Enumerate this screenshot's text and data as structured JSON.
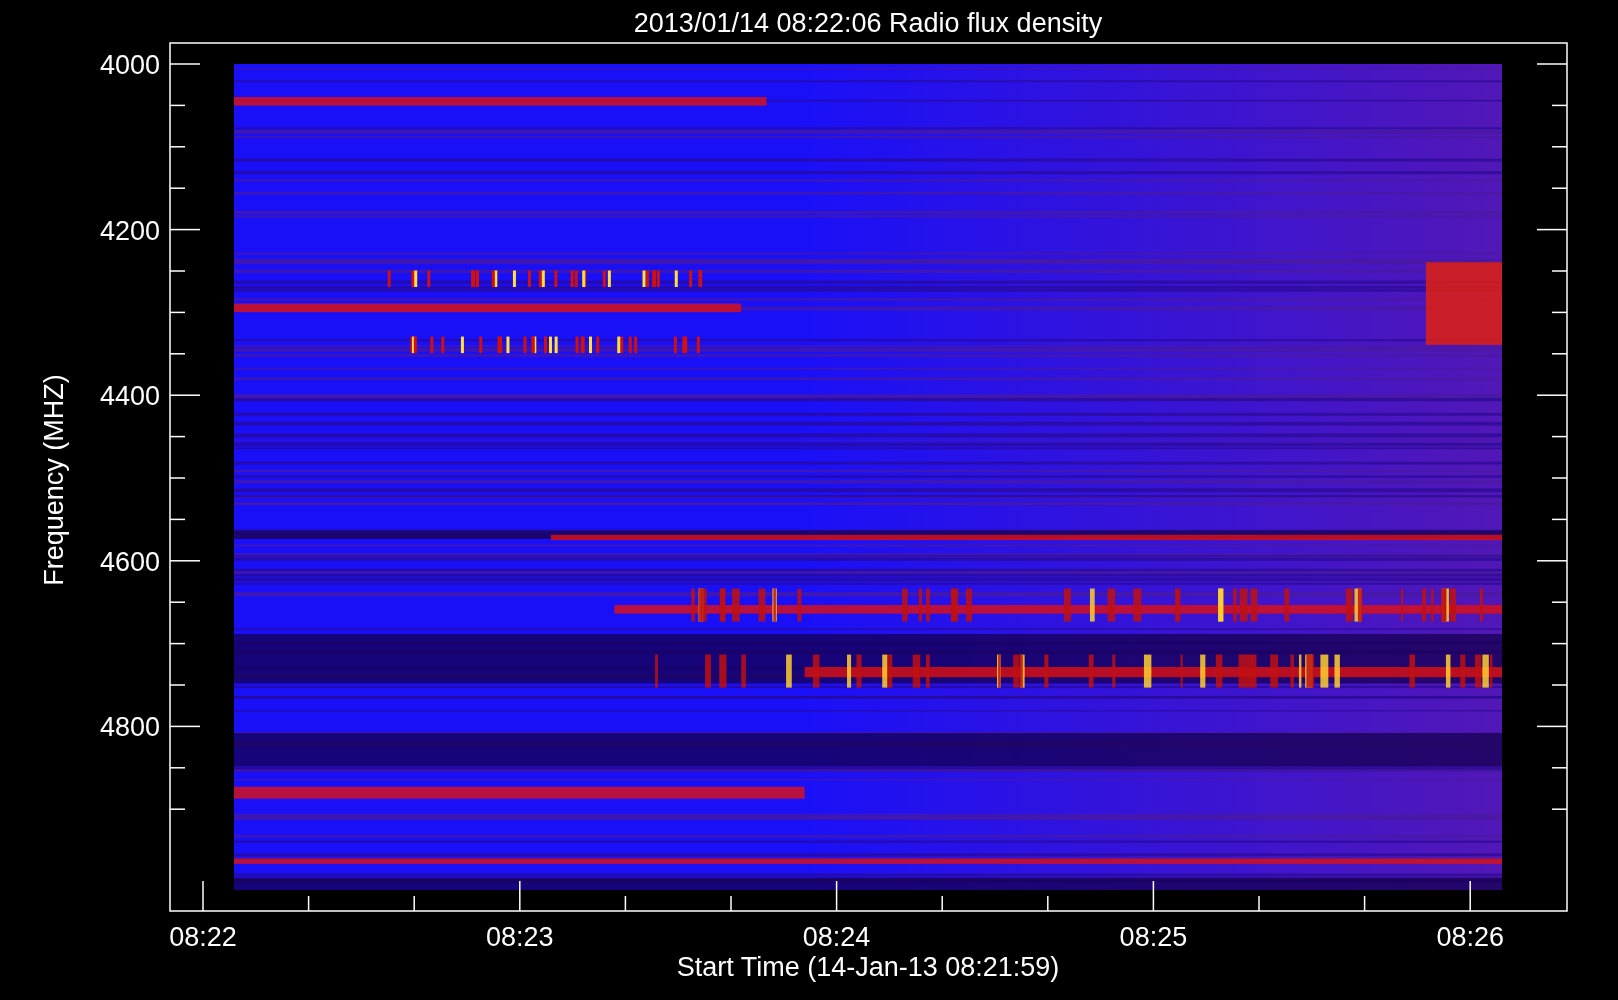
{
  "plot": {
    "title": "2013/01/14 08:22:06 Radio flux density",
    "ylabel": "Frequency (MHZ)",
    "xlabel": "Start Time (14-Jan-13 08:21:59)",
    "yticks": [
      "4000",
      "4200",
      "4400",
      "4600",
      "4800"
    ],
    "xticks": [
      "08:22",
      "08:23",
      "08:24",
      "08:25",
      "08:26"
    ]
  }
}
